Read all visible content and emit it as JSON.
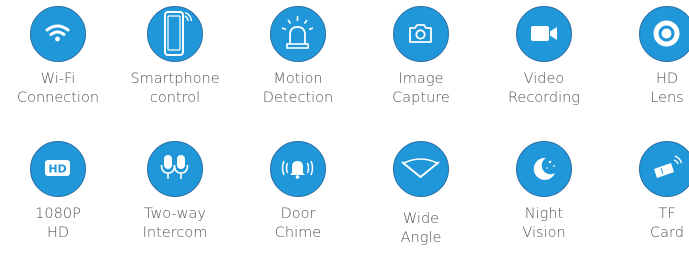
{
  "colors": {
    "circle_fill": "#1f97d8",
    "circle_border": "#2c6fa6",
    "icon": "#ffffff",
    "text": "#555555"
  },
  "features": [
    {
      "icon": "wifi-icon",
      "line1": "Wi-Fi",
      "line2": "Connection"
    },
    {
      "icon": "smartphone-icon",
      "line1": "Smartphone",
      "line2": "control"
    },
    {
      "icon": "alarm-light-icon",
      "line1": "Motion",
      "line2": "Detection"
    },
    {
      "icon": "camera-icon",
      "line1": "Image",
      "line2": "Capture"
    },
    {
      "icon": "video-camera-icon",
      "line1": "Video",
      "line2": "Recording"
    },
    {
      "icon": "lens-icon",
      "line1": "HD",
      "line2": "Lens"
    },
    {
      "icon": "hd-badge-icon",
      "line1": "1080P",
      "line2": "HD"
    },
    {
      "icon": "intercom-icon",
      "line1": "Two-way",
      "line2": "Intercom"
    },
    {
      "icon": "bell-icon",
      "line1": "Door",
      "line2": "Chime"
    },
    {
      "icon": "wide-angle-icon",
      "line1": "Wide",
      "line2": "Angle"
    },
    {
      "icon": "moon-icon",
      "line1": "Night",
      "line2": "Vision"
    },
    {
      "icon": "sd-card-icon",
      "line1": "TF",
      "line2": "Card"
    }
  ]
}
